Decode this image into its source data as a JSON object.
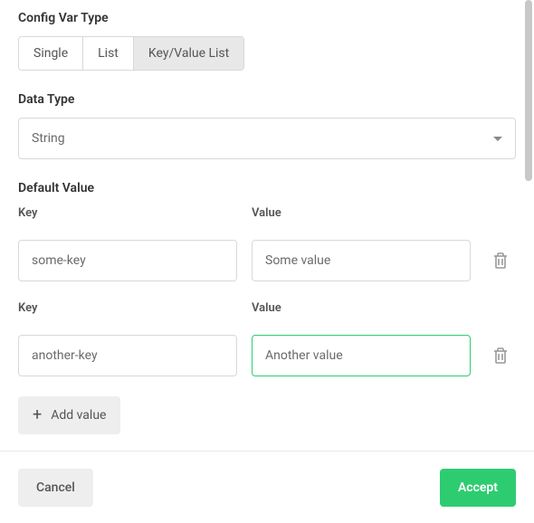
{
  "config_var_type": {
    "label": "Config Var Type",
    "tabs": [
      {
        "label": "Single"
      },
      {
        "label": "List"
      },
      {
        "label": "Key/Value List"
      }
    ]
  },
  "data_type": {
    "label": "Data Type",
    "selected": "String"
  },
  "default_value": {
    "label": "Default Value",
    "key_label": "Key",
    "value_label": "Value",
    "rows": [
      {
        "key": "some-key",
        "value": "Some value"
      },
      {
        "key": "another-key",
        "value": "Another value"
      }
    ],
    "add_label": "Add value"
  },
  "footer": {
    "cancel": "Cancel",
    "accept": "Accept"
  },
  "colors": {
    "accent": "#2ecc71"
  }
}
